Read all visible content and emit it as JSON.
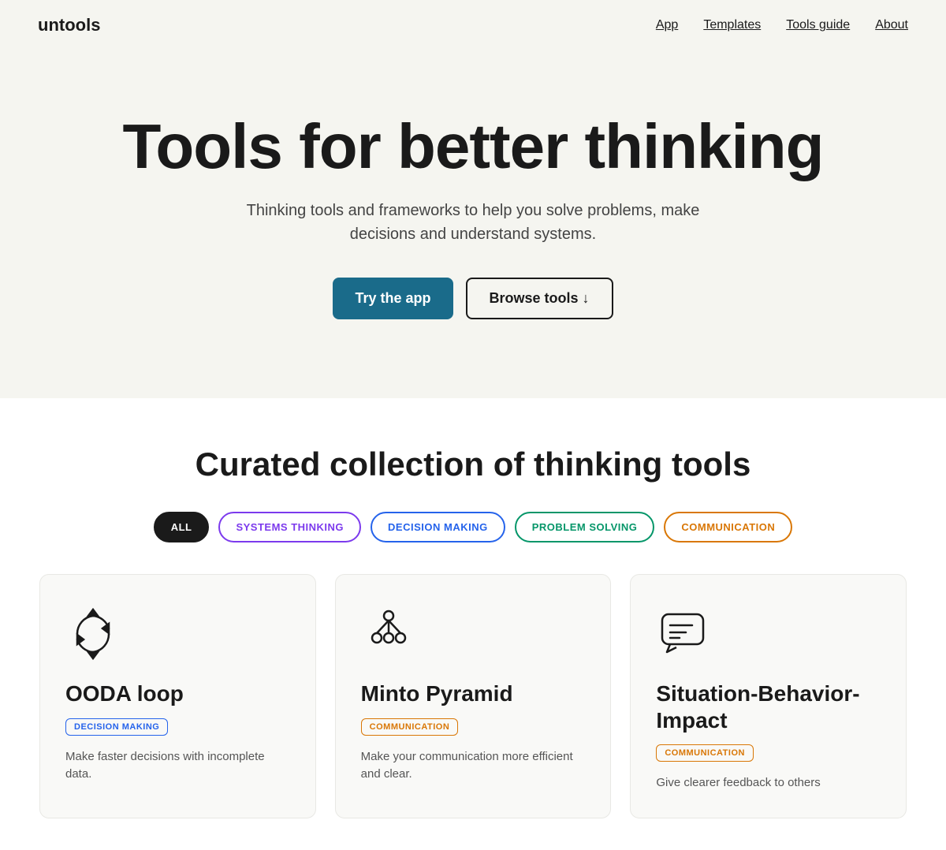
{
  "nav": {
    "logo": "untools",
    "links": [
      {
        "id": "app",
        "label": "App",
        "href": "#"
      },
      {
        "id": "templates",
        "label": "Templates",
        "href": "#"
      },
      {
        "id": "tools-guide",
        "label": "Tools guide",
        "href": "#"
      },
      {
        "id": "about",
        "label": "About",
        "href": "#"
      }
    ]
  },
  "hero": {
    "heading": "Tools for better thinking",
    "subheading": "Thinking tools and frameworks to help you solve problems, make decisions and understand systems.",
    "btn_primary": "Try the app",
    "btn_secondary": "Browse tools ↓"
  },
  "tools_section": {
    "heading": "Curated collection of thinking tools",
    "filters": [
      {
        "id": "all",
        "label": "ALL",
        "active": true,
        "style": "active"
      },
      {
        "id": "systems",
        "label": "SYSTEMS THINKING",
        "active": false,
        "style": "systems"
      },
      {
        "id": "decision",
        "label": "DECISION MAKING",
        "active": false,
        "style": "decision"
      },
      {
        "id": "problem",
        "label": "PROBLEM SOLVING",
        "active": false,
        "style": "problem"
      },
      {
        "id": "communication",
        "label": "COMMUNICATION",
        "active": false,
        "style": "communication"
      }
    ],
    "cards": [
      {
        "id": "ooda",
        "title": "OODA loop",
        "tag": "DECISION MAKING",
        "tag_style": "decision",
        "description": "Make faster decisions with incomplete data.",
        "icon": "ooda"
      },
      {
        "id": "minto",
        "title": "Minto Pyramid",
        "tag": "COMMUNICATION",
        "tag_style": "communication",
        "description": "Make your communication more efficient and clear.",
        "icon": "minto"
      },
      {
        "id": "sbi",
        "title": "Situation-Behavior-Impact",
        "tag": "COMMUNICATION",
        "tag_style": "communication",
        "description": "Give clearer feedback to others",
        "icon": "sbi"
      }
    ]
  }
}
